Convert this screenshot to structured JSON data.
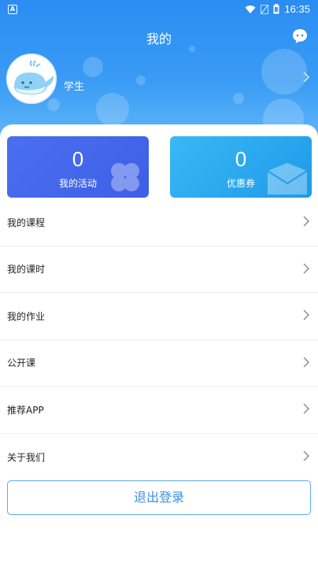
{
  "status_bar": {
    "time": "16:35",
    "app_icon": "A",
    "icons": [
      "wifi-icon",
      "signal-icon",
      "battery-icon"
    ]
  },
  "header": {
    "title": "我的",
    "chat_icon": "chat-bubble-icon"
  },
  "profile": {
    "username": "学生",
    "avatar": "whale-avatar"
  },
  "stats": {
    "activities": {
      "value": "0",
      "label": "我的活动"
    },
    "coupons": {
      "value": "0",
      "label": "优惠券"
    }
  },
  "menu": {
    "items": [
      {
        "label": "我的课程"
      },
      {
        "label": "我的课时"
      },
      {
        "label": "我的作业"
      },
      {
        "label": "公开课"
      },
      {
        "label": "推荐APP"
      },
      {
        "label": "关于我们"
      }
    ]
  },
  "logout": {
    "label": "退出登录"
  },
  "colors": {
    "header_blue": "#3a9cf5",
    "card_left": "#4a6ff0",
    "card_right": "#1e9ae8",
    "logout_border": "#5aa8f0"
  }
}
